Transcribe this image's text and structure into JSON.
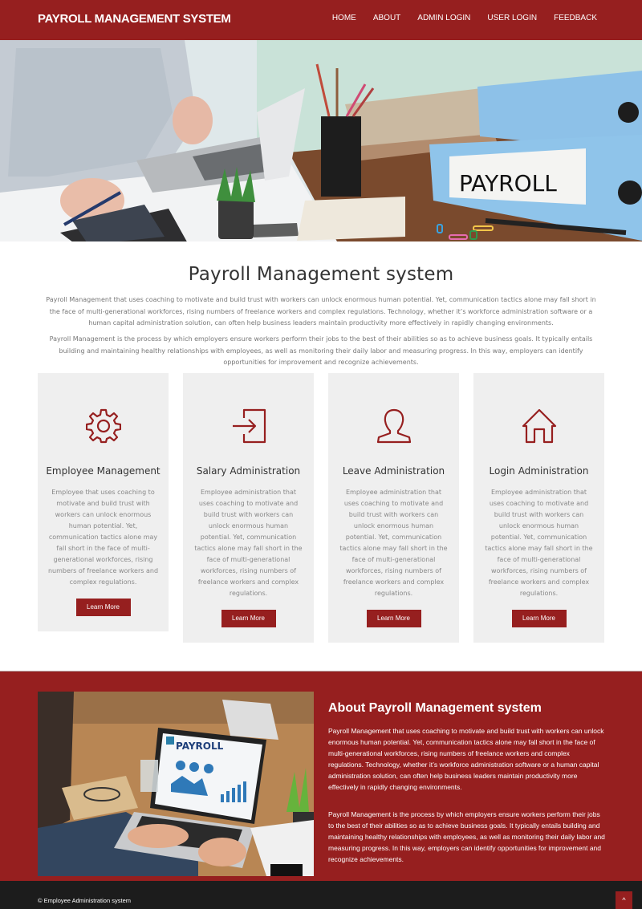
{
  "navbar": {
    "brand": "PAYROLL MANAGEMENT SYSTEM",
    "links": [
      "HOME",
      "ABOUT",
      "ADMIN LOGIN",
      "USER LOGIN",
      "FEEDBACK"
    ]
  },
  "hero": {
    "binder_label": "PAYROLL"
  },
  "intro": {
    "title": "Payroll Management system",
    "paragraph1": "Payroll Management that uses coaching to motivate and build trust with workers can unlock enormous human potential. Yet, communication tactics alone may fall short in the face of multi-generational workforces, rising numbers of freelance workers and complex regulations. Technology, whether it’s workforce administration software or a human capital administration solution, can often help business leaders maintain productivity more effectively in rapidly changing environments.",
    "paragraph2": "Payroll Management is the process by which employers ensure workers perform their jobs to the best of their abilities so as to achieve business goals. It typically entails building and maintaining healthy relationships with employees, as well as monitoring their daily labor and measuring progress. In this way, employers can identify opportunities for improvement and recognize achievements."
  },
  "cards": [
    {
      "icon": "gear-icon",
      "title": "Employee Management",
      "text": "Employee that uses coaching to motivate and build trust with workers can unlock enormous human potential. Yet, communication tactics alone may fall short in the face of multi-generational workforces, rising numbers of freelance workers and complex regulations.",
      "button": "Learn More"
    },
    {
      "icon": "sign-in-icon",
      "title": "Salary Administration",
      "text": "Employee administration that uses coaching to motivate and build trust with workers can unlock enormous human potential. Yet, communication tactics alone may fall short in the face of multi-generational workforces, rising numbers of freelance workers and complex regulations.",
      "button": "Learn More"
    },
    {
      "icon": "user-icon",
      "title": "Leave Administration",
      "text": "Employee administration that uses coaching to motivate and build trust with workers can unlock enormous human potential. Yet, communication tactics alone may fall short in the face of multi-generational workforces, rising numbers of freelance workers and complex regulations.",
      "button": "Learn More"
    },
    {
      "icon": "home-icon",
      "title": "Login Administration",
      "text": "Employee administration that uses coaching to motivate and build trust with workers can unlock enormous human potential. Yet, communication tactics alone may fall short in the face of multi-generational workforces, rising numbers of freelance workers and complex regulations.",
      "button": "Learn More"
    }
  ],
  "about": {
    "title": "About Payroll Management system",
    "paragraph1": "Payroll Management that uses coaching to motivate and build trust with workers can unlock enormous human potential. Yet, communication tactics alone may fall short in the face of multi-generational workforces, rising numbers of freelance workers and complex regulations. Technology, whether it’s workforce administration software or a human capital administration solution, can often help business leaders maintain productivity more effectively in rapidly changing environments.",
    "paragraph2": "Payroll Management is the process by which employers ensure workers perform their jobs to the best of their abilities so as to achieve business goals. It typically entails building and maintaining healthy relationships with employees, as well as monitoring their daily labor and measuring progress. In this way, employers can identify opportunities for improvement and recognize achievements.",
    "screen_label": "PAYROLL"
  },
  "footer": {
    "copyright": "© Employee Administration system",
    "to_top": "^"
  },
  "colors": {
    "brand": "#961f1f",
    "card_bg": "#efefef",
    "footer_bg": "#1c1c1c"
  }
}
